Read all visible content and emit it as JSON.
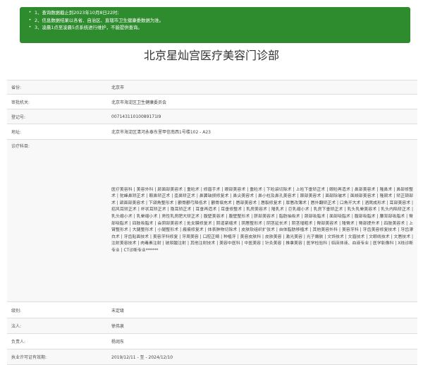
{
  "notice": {
    "lines": [
      "1、查询数据截止到2023年10月8日22时;",
      "2、信息数据结果以各省、自治区、直辖市卫生健康委数据为准。",
      "3、凌晨1点至凌晨5点系统进行维护，不能提供查询。"
    ]
  },
  "page_title": "北京星灿宫医疗美容门诊部",
  "fields": [
    {
      "label": "省份:",
      "value": "北京市"
    },
    {
      "label": "审批机关:",
      "value": "北京市海淀区卫生健康委员会"
    },
    {
      "label": "登记号:",
      "value": "00714311010089171I9"
    },
    {
      "label": "地址:",
      "value": "北京市海淀区清河永泰东里甲信南西1号楼102 - A23"
    },
    {
      "label": "诊疗科目:",
      "value": "医疗美容科 | 美容外科 | 颜面部美容术 | 重睑术 | 修眉手术 | 眼部美容术 | 重睑术 | 下睑袋切除术 | 上睑下垂矫正术 | 眼睑再造术 | 鼻部美容术 | 隆鼻术 | 鼻部修整术 | 驼峰鼻矫正术 | 鞍鼻矫正术 | 歪鼻矫正术 | 鼻翼缺损修复术 | 鼻尖美容术 | 鼻小柱及鼻孔美容术 | 颞部美容术 | 面部除皱术 | 面颊部美容术 | 隆颏术 | 矫正颏部术 | 颌面部美容术 | 下颌角整形术 | 颧骨颧弓降低术 | 颧骨填充术 | 唇部美容术 | 唇裂修复术 | 厚唇改薄术 | 唇外翻矫正术 | 口角开大术 | 酒窝成形术 | 耳部美容术 | 招风耳矫正术 | 杯状耳矫正术 | 隐耳矫正术 | 耳垂再造术 | 耳垂修整术 | 乳房美容术 | 隆乳术 | 巨乳缩小术 | 乳房下垂矫正术 | 乳头乳晕美容术 | 乳头内陷矫正术 | 乳头缩小术 | 乳晕缩小术 | 男性乳房肥大矫正术 | 腹壁美容术 | 腹壁整形术 | 脐部美容术 | 脂肪抽吸术 | 颈部吸脂术 | 面部吸脂术 | 腹部吸脂术 | 腰背部吸脂术 | 臀部吸脂术 | 四肢吸脂术 | 会阴部美容术 | 处女膜修复术 | 阴道紧缩术 | 阴唇整形术 | 阴茎延长术 | 阴茎增粗术 | 臀部美容术 | 隆臀术 | 臀部提升术 | 四肢美容术 | 上臂整形术 | 大腿整形术 | 小腿整形术 | 瘢痕修复术 | 体表肿物切除术 | 皮肤软组织扩张术 | 自体脂肪移植术 | 其他美容外科 | 美容牙科 | 牙齿美容修复技术 | 牙齿漂白术 | 牙齿贴面技术 | 美容牙科修复 | 牙周美容 | 口腔正畸 | 种植牙 | 美容皮肤科 | 皮肤美容 | 激光美容 | 光子嫩肤 | 文饰技术 | 文眉技术 | 文眼线技术 | 文唇技术 | 注射美容技术 | 肉毒素注射 | 玻尿酸注射 | 其他注射技术 | 美容中医科 | 中医美容 | 针灸美容 | 推拿美容 | 医学检验科 | 临床体液、血液专业 | 医学影像科 | X线诊断专业 | CT诊断专业******"
    },
    {
      "label": "级别:",
      "value": "未定级"
    },
    {
      "label": "法人:",
      "value": "徐伟泉"
    },
    {
      "label": "负责人:",
      "value": "杨润东"
    },
    {
      "label": "执业许可证有效期:",
      "value": "2019/12/11 - 至 - 2024/12/10"
    }
  ],
  "colors": {
    "notice_bg": "#2e8b2e",
    "row_alt": "#f8f8f8"
  }
}
